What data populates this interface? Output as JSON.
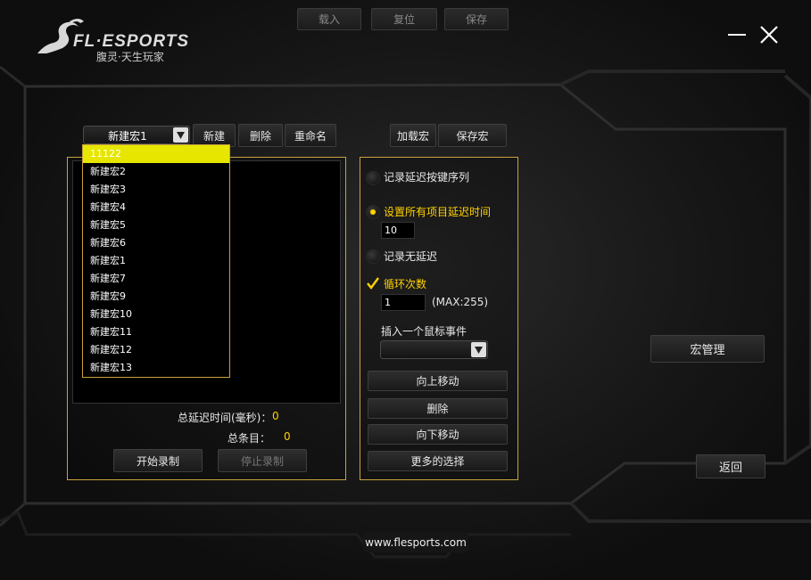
{
  "brand": {
    "name": "FL·ESPORTS",
    "slogan": "腹灵·天生玩家"
  },
  "top_buttons": {
    "load": "载入",
    "reset": "复位",
    "save": "保存"
  },
  "window": {
    "minimize": "—",
    "close": "✕"
  },
  "macro": {
    "selected": "新建宏1",
    "new_label": "新建",
    "delete_label": "删除",
    "rename_label": "重命名",
    "load_macro_label": "加载宏",
    "save_macro_label": "保存宏",
    "dropdown_items": [
      "11122",
      "新建宏2",
      "新建宏3",
      "新建宏4",
      "新建宏5",
      "新建宏6",
      "新建宏1",
      "新建宏7",
      "新建宏9",
      "新建宏10",
      "新建宏11",
      "新建宏12",
      "新建宏13"
    ],
    "total_delay_label": "总延迟时间(毫秒)：",
    "total_delay_value": "0",
    "total_items_label": "总条目：",
    "total_items_value": "0",
    "start_record": "开始录制",
    "stop_record": "停止录制"
  },
  "options": {
    "record_delay": "记录延迟按键序列",
    "set_all_delay": "设置所有项目延迟时间",
    "delay_value": "10",
    "no_delay": "记录无延迟",
    "loop_count_label": "循环次数",
    "loop_value": "1",
    "loop_max": "(MAX:255)",
    "insert_mouse_label": "插入一个鼠标事件",
    "move_up": "向上移动",
    "delete": "删除",
    "move_down": "向下移动",
    "more_options": "更多的选择"
  },
  "side": {
    "macro_manage": "宏管理",
    "back": "返回"
  },
  "footer": {
    "url": "www.flesports.com"
  },
  "colors": {
    "accent": "#ffd200",
    "panel_border": "#c8a23c",
    "selected_item": "#e6e600"
  }
}
